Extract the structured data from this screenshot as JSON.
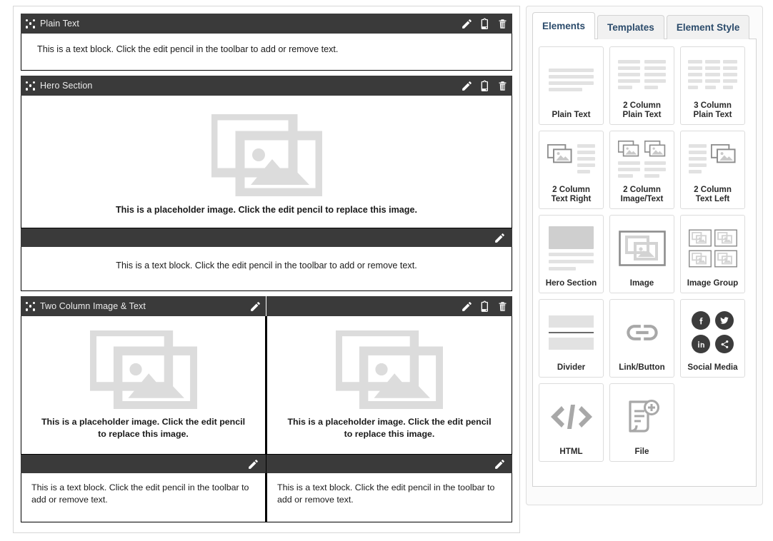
{
  "canvas": {
    "blocks": [
      {
        "id": "plain-text",
        "title": "Plain Text",
        "tools": [
          "edit-pencil-icon",
          "clipboard-copy-icon",
          "trash-delete-icon"
        ],
        "body_text": "This is a text block. Click the edit pencil in the toolbar to add or remove text."
      },
      {
        "id": "hero-section",
        "title": "Hero Section",
        "tools": [
          "edit-pencil-icon",
          "clipboard-copy-icon",
          "trash-delete-icon"
        ],
        "image_caption": "This is a placeholder image. Click the edit pencil to replace this image.",
        "sub_tools": [
          "edit-pencil-icon"
        ],
        "body_text": "This is a text block. Click the edit pencil in the toolbar to add or remove text."
      },
      {
        "id": "two-column-image-text",
        "title": "Two Column Image & Text",
        "left_tools": [
          "edit-pencil-icon"
        ],
        "right_tools": [
          "edit-pencil-icon",
          "clipboard-copy-icon",
          "trash-delete-icon"
        ],
        "columns": [
          {
            "image_caption": "This is a placeholder image. Click the edit pencil to replace this image.",
            "sub_tools": [
              "edit-pencil-icon"
            ],
            "body_text": "This is a text block. Click the edit pencil in the toolbar to add or remove text."
          },
          {
            "image_caption": "This is a placeholder image. Click the edit pencil to replace this image.",
            "sub_tools": [
              "edit-pencil-icon"
            ],
            "body_text": "This is a text block. Click the edit pencil in the toolbar to add or remove text."
          }
        ]
      }
    ]
  },
  "panel": {
    "tabs": [
      {
        "label": "Elements",
        "active": true
      },
      {
        "label": "Templates",
        "active": false
      },
      {
        "label": "Element Style",
        "active": false
      }
    ],
    "elements": [
      {
        "label": "Plain Text",
        "art": "plain-text"
      },
      {
        "label": "2 Column\nPlain Text",
        "art": "two-col-text"
      },
      {
        "label": "3 Column\nPlain Text",
        "art": "three-col-text"
      },
      {
        "label": "2 Column\nText Right",
        "art": "text-right"
      },
      {
        "label": "2 Column\nImage/Text",
        "art": "image-text"
      },
      {
        "label": "2 Column\nText Left",
        "art": "text-left"
      },
      {
        "label": "Hero Section",
        "art": "hero"
      },
      {
        "label": "Image",
        "art": "image"
      },
      {
        "label": "Image Group",
        "art": "image-group"
      },
      {
        "label": "Divider",
        "art": "divider"
      },
      {
        "label": "Link/Button",
        "art": "link"
      },
      {
        "label": "Social Media",
        "art": "social"
      },
      {
        "label": "HTML",
        "art": "html"
      },
      {
        "label": "File",
        "art": "file"
      }
    ],
    "social_icons": [
      "facebook-icon",
      "twitter-icon",
      "linkedin-icon",
      "share-icon"
    ]
  },
  "colors": {
    "header_dark": "#3a3a3a",
    "placeholder_gray": "#dcdcdc",
    "tab_text": "#2b4b6b",
    "canvas_border": "#d7d7d7"
  }
}
